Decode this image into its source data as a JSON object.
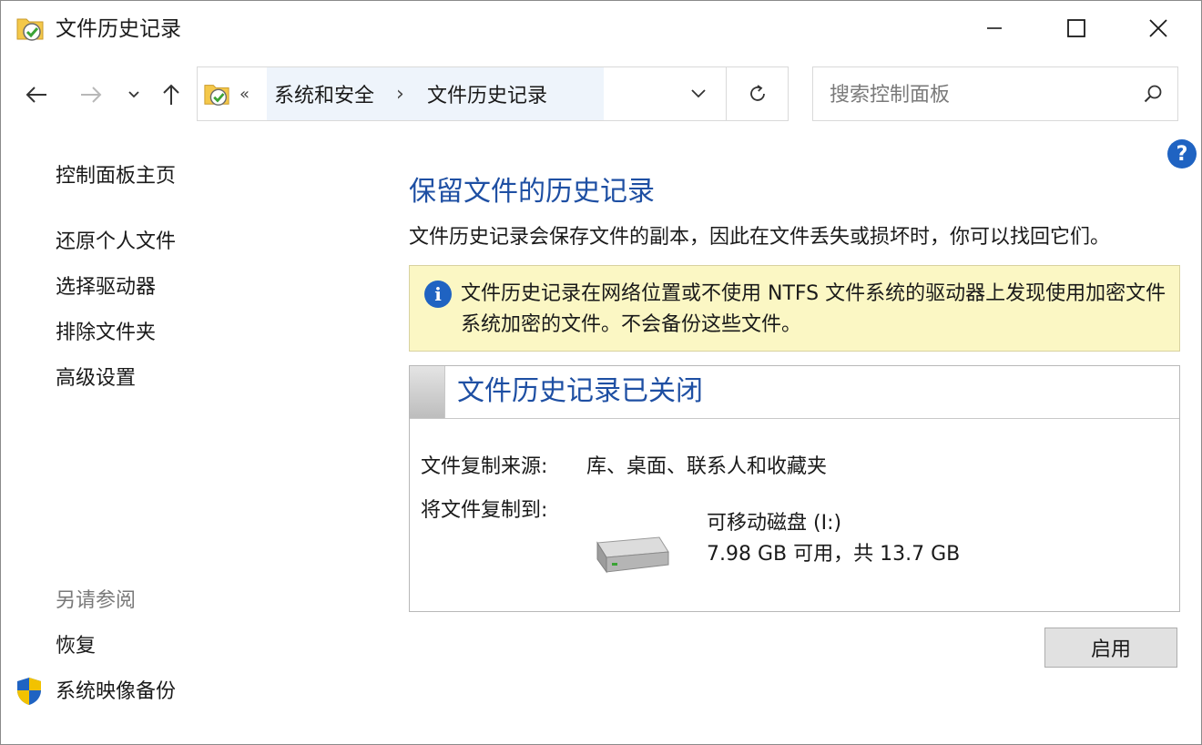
{
  "window": {
    "title": "文件历史记录"
  },
  "address": {
    "overflow": "«",
    "crumbs": [
      "系统和安全",
      "文件历史记录"
    ],
    "separator": "›"
  },
  "search": {
    "placeholder": "搜索控制面板"
  },
  "help": {
    "label": "?"
  },
  "sidebar": {
    "home": "控制面板主页",
    "links": [
      "还原个人文件",
      "选择驱动器",
      "排除文件夹",
      "高级设置"
    ],
    "see_also_title": "另请参阅",
    "see_also": [
      "恢复",
      "系统映像备份"
    ]
  },
  "main": {
    "heading": "保留文件的历史记录",
    "description": "文件历史记录会保存文件的副本，因此在文件丢失或损坏时，你可以找回它们。",
    "info_icon": "i",
    "info_text": "文件历史记录在网络位置或不使用 NTFS 文件系统的驱动器上发现使用加密文件系统加密的文件。不会备份这些文件。",
    "panel": {
      "status_title": "文件历史记录已关闭",
      "copy_from_label": "文件复制来源:",
      "copy_from_value": "库、桌面、联系人和收藏夹",
      "copy_to_label": "将文件复制到:",
      "drive_name": "可移动磁盘 (I:)",
      "drive_space": "7.98 GB 可用，共 13.7 GB"
    },
    "enable_button": "启用"
  },
  "colors": {
    "link_blue": "#1e4fa3",
    "info_bg": "#fbf7c4",
    "accent": "#1f63c2"
  }
}
